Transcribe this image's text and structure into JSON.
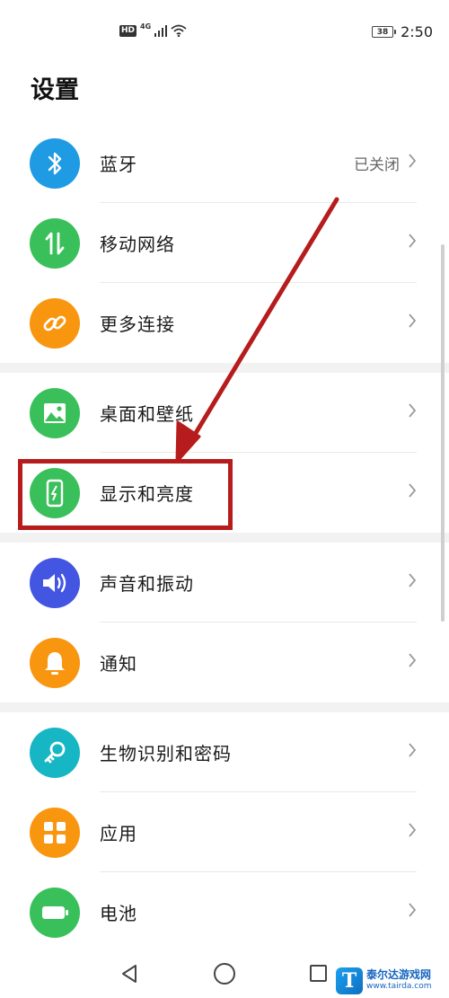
{
  "status_bar": {
    "hd": "HD",
    "network": "4G",
    "battery": "38",
    "time": "2:50"
  },
  "page": {
    "title": "设置"
  },
  "settings": [
    {
      "label": "蓝牙",
      "value": "已关闭",
      "icon": "bluetooth-icon",
      "color": "#1e9be3"
    },
    {
      "label": "移动网络",
      "icon": "mobile-data-icon",
      "color": "#3ac05a"
    },
    {
      "label": "更多连接",
      "icon": "link-icon",
      "color": "#f9960f"
    },
    {
      "label": "桌面和壁纸",
      "icon": "wallpaper-icon",
      "color": "#3ac05a"
    },
    {
      "label": "显示和亮度",
      "icon": "display-brightness-icon",
      "color": "#3ac05a"
    },
    {
      "label": "声音和振动",
      "icon": "volume-icon",
      "color": "#4356e1"
    },
    {
      "label": "通知",
      "icon": "bell-icon",
      "color": "#f9960f"
    },
    {
      "label": "生物识别和密码",
      "icon": "key-icon",
      "color": "#17b6c4"
    },
    {
      "label": "应用",
      "icon": "apps-grid-icon",
      "color": "#f9960f"
    },
    {
      "label": "电池",
      "icon": "battery-icon",
      "color": "#3ac05a"
    }
  ],
  "annotation": {
    "color": "#b71c1c",
    "highlighted_item": "显示和亮度"
  },
  "watermark": {
    "logo": "T",
    "name": "泰尔达游戏网",
    "url": "www.tairda.com"
  }
}
